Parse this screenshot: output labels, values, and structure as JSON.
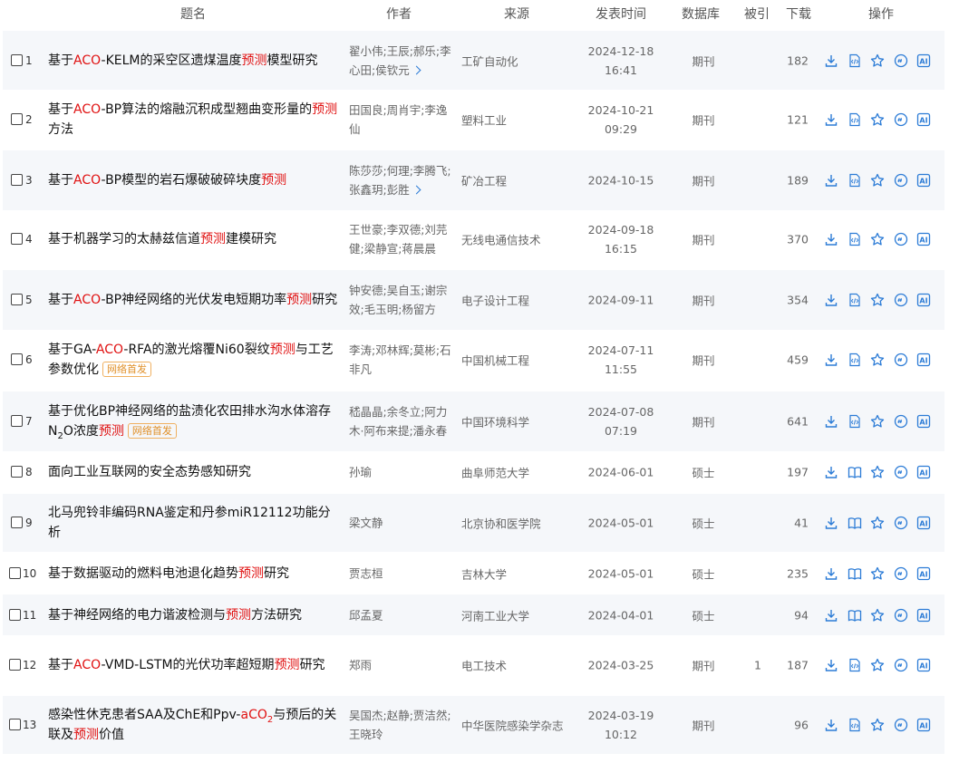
{
  "header": {
    "title": "题名",
    "author": "作者",
    "source": "来源",
    "date": "发表时间",
    "db": "数据库",
    "cite": "被引",
    "download": "下载",
    "ops": "操作"
  },
  "colors": {
    "highlight": "#e01010",
    "icon": "#2b7bd6",
    "tag": "#e0902a",
    "alt_row": "#f5f7fa"
  },
  "rows": [
    {
      "num": "1",
      "title": [
        [
          "基于",
          0
        ],
        [
          "ACO",
          1
        ],
        [
          "-KELM的采空区遗煤温度",
          0
        ],
        [
          "预测",
          1
        ],
        [
          "模型研究",
          0
        ]
      ],
      "tag": "",
      "authors": "翟小伟;王辰;郝乐;李心田;侯钦元",
      "more": true,
      "source": "工矿自动化",
      "date": "2024-12-18",
      "time": "16:41",
      "db": "期刊",
      "cite": "",
      "downloads": "182",
      "read_icon": "html"
    },
    {
      "num": "2",
      "title": [
        [
          "基于",
          0
        ],
        [
          "ACO",
          1
        ],
        [
          "-BP算法的熔融沉积成型翘曲变形量的",
          0
        ],
        [
          "预测",
          1
        ],
        [
          "方法",
          0
        ]
      ],
      "tag": "",
      "authors": "田国良;周肖宇;李逸仙",
      "more": false,
      "source": "塑料工业",
      "date": "2024-10-21",
      "time": "09:29",
      "db": "期刊",
      "cite": "",
      "downloads": "121",
      "read_icon": "html"
    },
    {
      "num": "3",
      "title": [
        [
          "基于",
          0
        ],
        [
          "ACO",
          1
        ],
        [
          "-BP模型的岩石爆破破碎块度",
          0
        ],
        [
          "预测",
          1
        ]
      ],
      "tag": "",
      "authors": "陈莎莎;何理;李腾飞;张鑫玥;彭胜",
      "more": true,
      "source": "矿冶工程",
      "date": "2024-10-15",
      "time": "",
      "db": "期刊",
      "cite": "",
      "downloads": "189",
      "read_icon": "html"
    },
    {
      "num": "4",
      "title": [
        [
          "基于机器学习的太赫兹信道",
          0
        ],
        [
          "预测",
          1
        ],
        [
          "建模研究",
          0
        ]
      ],
      "tag": "",
      "authors": "王世豪;李双德;刘芫健;梁静宣;蒋晨晨",
      "more": false,
      "source": "无线电通信技术",
      "date": "2024-09-18",
      "time": "16:15",
      "db": "期刊",
      "cite": "",
      "downloads": "370",
      "read_icon": "html"
    },
    {
      "num": "5",
      "title": [
        [
          "基于",
          0
        ],
        [
          "ACO",
          1
        ],
        [
          "-BP神经网络的光伏发电短期功率",
          0
        ],
        [
          "预测",
          1
        ],
        [
          "研究",
          0
        ]
      ],
      "tag": "",
      "authors": "钟安德;吴自玉;谢宗效;毛玉明;杨留方",
      "more": false,
      "source": "电子设计工程",
      "date": "2024-09-11",
      "time": "",
      "db": "期刊",
      "cite": "",
      "downloads": "354",
      "read_icon": "html"
    },
    {
      "num": "6",
      "title": [
        [
          "基于GA-",
          0
        ],
        [
          "ACO",
          1
        ],
        [
          "-RFA的激光熔覆Ni60裂纹",
          0
        ],
        [
          "预测",
          1
        ],
        [
          "与工艺参数优化",
          0
        ]
      ],
      "tag": "网络首发",
      "authors": "李涛;邓林辉;莫彬;石非凡",
      "more": false,
      "source": "中国机械工程",
      "date": "2024-07-11",
      "time": "11:55",
      "db": "期刊",
      "cite": "",
      "downloads": "459",
      "read_icon": "html"
    },
    {
      "num": "7",
      "title": [
        [
          "基于优化BP神经网络的盐渍化农田排水沟水体溶存N",
          0
        ],
        [
          "2",
          2
        ],
        [
          "O浓度",
          0
        ],
        [
          "预测",
          1
        ]
      ],
      "tag": "网络首发",
      "authors": "嵇晶晶;余冬立;阿力木·阿布来提;潘永春",
      "more": false,
      "source": "中国环境科学",
      "date": "2024-07-08",
      "time": "07:19",
      "db": "期刊",
      "cite": "",
      "downloads": "641",
      "read_icon": "html"
    },
    {
      "num": "8",
      "title": [
        [
          "面向工业互联网的安全态势感知研究",
          0
        ]
      ],
      "tag": "",
      "authors": "孙瑜",
      "more": false,
      "source": "曲阜师范大学",
      "date": "2024-06-01",
      "time": "",
      "db": "硕士",
      "cite": "",
      "downloads": "197",
      "read_icon": "book"
    },
    {
      "num": "9",
      "title": [
        [
          "北马兜铃非编码RNA鉴定和丹参miR12112功能分析",
          0
        ]
      ],
      "tag": "",
      "authors": "梁文静",
      "more": false,
      "source": "北京协和医学院",
      "date": "2024-05-01",
      "time": "",
      "db": "硕士",
      "cite": "",
      "downloads": "41",
      "read_icon": "book"
    },
    {
      "num": "10",
      "title": [
        [
          "基于数据驱动的燃料电池退化趋势",
          0
        ],
        [
          "预测",
          1
        ],
        [
          "研究",
          0
        ]
      ],
      "tag": "",
      "authors": "贾志桓",
      "more": false,
      "source": "吉林大学",
      "date": "2024-05-01",
      "time": "",
      "db": "硕士",
      "cite": "",
      "downloads": "235",
      "read_icon": "book"
    },
    {
      "num": "11",
      "title": [
        [
          "基于神经网络的电力谐波检测与",
          0
        ],
        [
          "预测",
          1
        ],
        [
          "方法研究",
          0
        ]
      ],
      "tag": "",
      "authors": "邱孟夏",
      "more": false,
      "source": "河南工业大学",
      "date": "2024-04-01",
      "time": "",
      "db": "硕士",
      "cite": "",
      "downloads": "94",
      "read_icon": "book"
    },
    {
      "num": "12",
      "title": [
        [
          "基于",
          0
        ],
        [
          "ACO",
          1
        ],
        [
          "-VMD-LSTM的光伏功率超短期",
          0
        ],
        [
          "预测",
          1
        ],
        [
          "研究",
          0
        ]
      ],
      "tag": "",
      "authors": "郑雨",
      "more": false,
      "source": "电工技术",
      "date": "2024-03-25",
      "time": "",
      "db": "期刊",
      "cite": "1",
      "downloads": "187",
      "read_icon": "html"
    },
    {
      "num": "13",
      "title": [
        [
          "感染性休克患者SAA及ChE和Ppv-",
          0
        ],
        [
          "aCO",
          1
        ],
        [
          "2",
          3
        ],
        [
          "与预后的关联及",
          0
        ],
        [
          "预测",
          1
        ],
        [
          "价值",
          0
        ]
      ],
      "tag": "",
      "authors": "吴国杰;赵静;贾洁然;王晓玲",
      "more": false,
      "source": "中华医院感染学杂志",
      "date": "2024-03-19",
      "time": "10:12",
      "db": "期刊",
      "cite": "",
      "downloads": "96",
      "read_icon": "html"
    }
  ],
  "actions": [
    "download-icon",
    "read-online-icon",
    "favorite-icon",
    "cite-icon",
    "ai-assistant-icon"
  ]
}
